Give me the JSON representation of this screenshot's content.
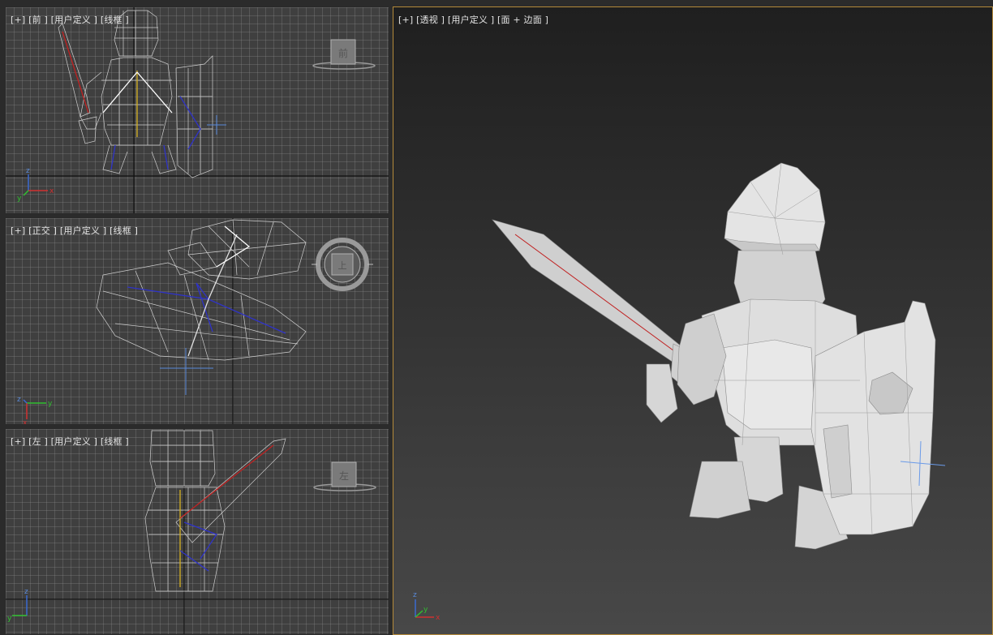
{
  "viewports": {
    "front": {
      "label": "[+] [前 ] [用户定义 ] [线框 ]",
      "viewcube_face": "前"
    },
    "ortho": {
      "label": "[+] [正交 ] [用户定义 ] [线框 ]",
      "viewcube_face": "上"
    },
    "left": {
      "label": "[+] [左 ] [用户定义 ] [线框 ]",
      "viewcube_face": "左"
    },
    "perspective": {
      "label": "[+] [透视 ] [用户定义 ] [面 + 边面 ]"
    }
  },
  "axes": {
    "x": "x",
    "y": "y",
    "z": "z"
  },
  "colors": {
    "active_border": "#b48a3a",
    "wireframe": "#c8c8c8",
    "bone_blue": "#2f33c8",
    "bone_red": "#c02020",
    "axis_x": "#d03030",
    "axis_y": "#30c030",
    "axis_z": "#3a6ad0"
  },
  "icons": [
    "viewcube-icon",
    "axis-tripod-icon",
    "steering-wheel-icon"
  ]
}
